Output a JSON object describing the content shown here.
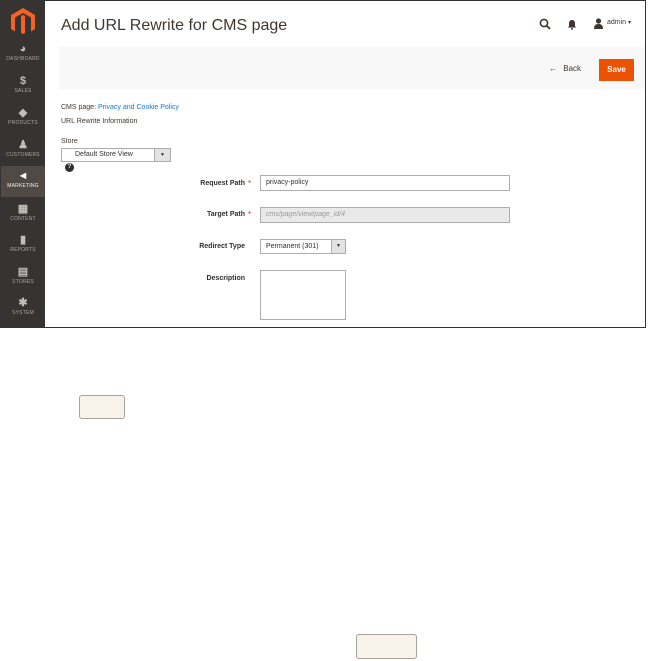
{
  "header": {
    "title": "Add URL Rewrite for CMS page",
    "user": "admin"
  },
  "sidebar": {
    "items": [
      {
        "label": "DASHBOARD",
        "icon": "dashboard-icon",
        "glyph": "◕"
      },
      {
        "label": "SALES",
        "icon": "dollar-icon",
        "glyph": "$"
      },
      {
        "label": "PRODUCTS",
        "icon": "cube-icon",
        "glyph": "◆"
      },
      {
        "label": "CUSTOMERS",
        "icon": "person-icon",
        "glyph": "♟"
      },
      {
        "label": "MARKETING",
        "icon": "megaphone-icon",
        "glyph": "◄"
      },
      {
        "label": "CONTENT",
        "icon": "layout-icon",
        "glyph": "▦"
      },
      {
        "label": "REPORTS",
        "icon": "bar-chart-icon",
        "glyph": "▮"
      },
      {
        "label": "STORES",
        "icon": "store-icon",
        "glyph": "▤"
      },
      {
        "label": "SYSTEM",
        "icon": "gear-icon",
        "glyph": "✱"
      }
    ],
    "active": "MARKETING"
  },
  "actions": {
    "back": "Back",
    "save": "Save"
  },
  "form": {
    "cms_page_prefix": "CMS page:",
    "cms_page_link": "Privacy and Cookie Policy",
    "section_title": "URL Rewrite Information",
    "store_label": "Store",
    "store_value": "Default Store View",
    "request_path_label": "Request Path",
    "request_path_value": "privacy-policy",
    "target_path_label": "Target Path",
    "target_path_value": "cms/page/view/page_id/4",
    "redirect_type_label": "Redirect Type",
    "redirect_type_value": "Permanent (301)",
    "description_label": "Description"
  },
  "colors": {
    "sidebar_bg": "#373330",
    "save_button": "#eb5202",
    "link": "#1979c3",
    "required": "#e22626"
  }
}
